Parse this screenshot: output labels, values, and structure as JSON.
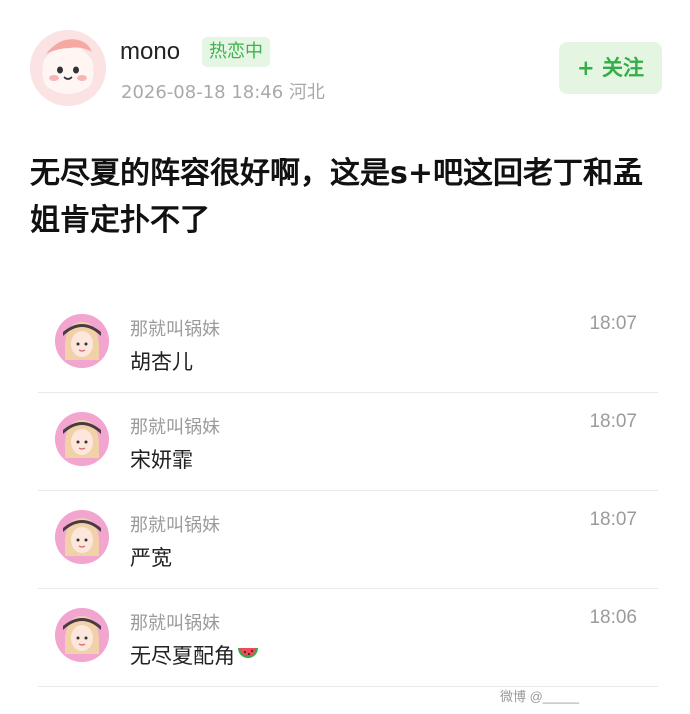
{
  "post": {
    "user": {
      "name": "mono",
      "badge": "热恋中",
      "meta": "2026-08-18 18:46  河北"
    },
    "follow_label": "+ 关注",
    "text": "无尽夏的阵容很好啊，这是s+吧这回老丁和孟姐肯定扑不了"
  },
  "comments": [
    {
      "user": "那就叫锅妹",
      "text": "胡杏儿",
      "time": "18:07"
    },
    {
      "user": "那就叫锅妹",
      "text": "宋妍霏",
      "time": "18:07"
    },
    {
      "user": "那就叫锅妹",
      "text": "严宽",
      "time": "18:07"
    },
    {
      "user": "那就叫锅妹",
      "text": "无尽夏配角",
      "time": "18:06"
    }
  ],
  "icons": {
    "main_avatar": "cartoon-avatar-icon",
    "comment_avatar": "girl-avatar-icon",
    "emoji": "watermelon-icon"
  },
  "watermark": "微博 @_____"
}
